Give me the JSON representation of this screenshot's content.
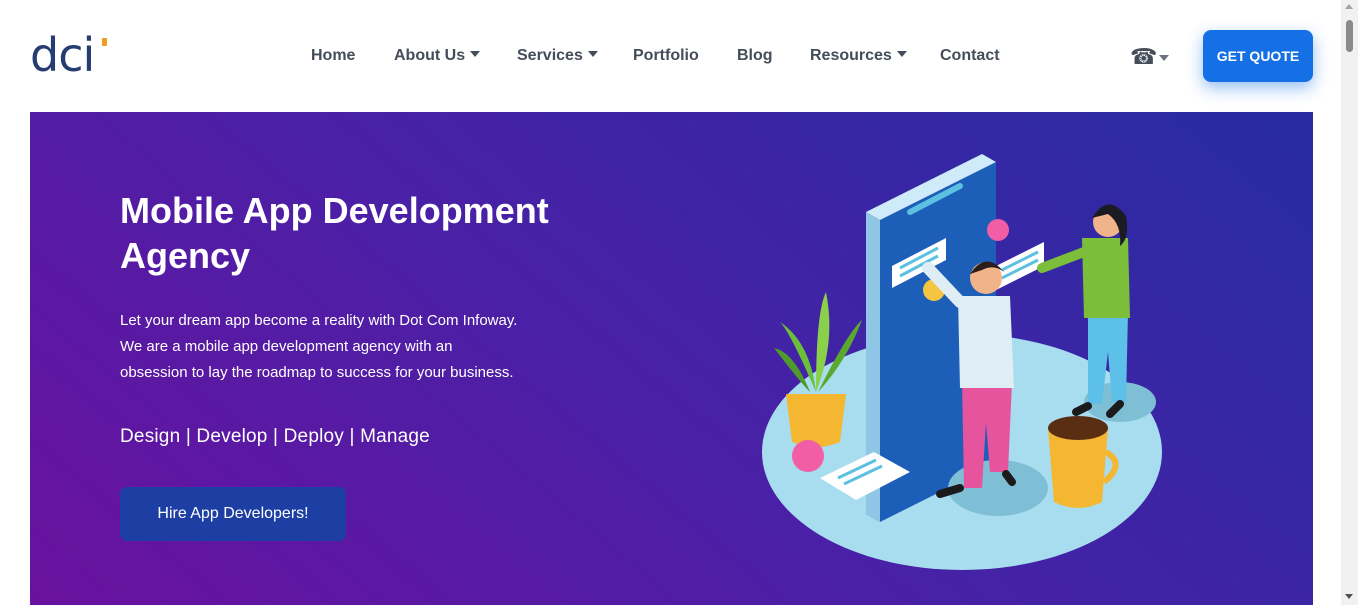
{
  "header": {
    "logo_text": "dci",
    "nav": [
      {
        "label": "Home",
        "dropdown": false
      },
      {
        "label": "About Us",
        "dropdown": true
      },
      {
        "label": "Services",
        "dropdown": true
      },
      {
        "label": "Portfolio",
        "dropdown": false
      },
      {
        "label": "Blog",
        "dropdown": false
      },
      {
        "label": "Resources",
        "dropdown": true
      },
      {
        "label": "Contact",
        "dropdown": false
      }
    ],
    "phone_icon": "☎",
    "cta_label": "GET QUOTE"
  },
  "hero": {
    "title": "Mobile App Development Agency",
    "description": "Let your dream app become a reality with Dot Com Infoway. We are a mobile app development agency with an obsession to lay the roadmap to success for your business.",
    "tagline": "Design | Develop | Deploy | Manage",
    "button_label": "Hire App Developers!"
  },
  "colors": {
    "brand_navy": "#263d71",
    "brand_orange": "#f39c22",
    "cta_blue": "#1570e6",
    "hero_start": "#6a119f",
    "hero_end": "#272ca3",
    "hire_button": "#1d3fa3"
  }
}
